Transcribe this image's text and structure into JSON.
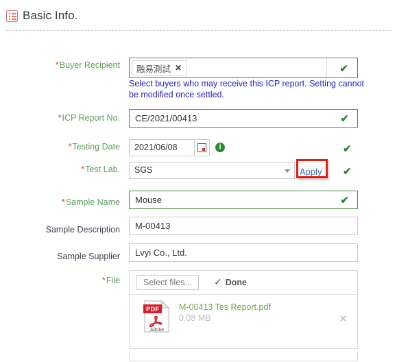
{
  "section": {
    "icon": "list-icon",
    "title": "Basic Info."
  },
  "form": {
    "buyer_recipient": {
      "label": "Buyer Recipient",
      "required_marker": "*",
      "tag": "融易測試",
      "tag_remove": "✕",
      "valid_check": "✔",
      "hint": "Select buyers who may receive this ICP report. Setting cannot be modified once settled."
    },
    "icp_report_no": {
      "label": "ICP Report No.",
      "required_marker": "*",
      "value": "CE/2021/00413",
      "valid_check": "✔"
    },
    "testing_date": {
      "label": "Testing Date",
      "required_marker": "*",
      "value": "2021/06/08",
      "calendar_icon": "calendar-icon",
      "info_icon": "i",
      "valid_check": "✔"
    },
    "test_lab": {
      "label": "Test Lab.",
      "required_marker": "*",
      "value": "SGS",
      "apply_label": "Apply",
      "valid_check": "✔"
    },
    "sample_name": {
      "label": "Sample Name",
      "required_marker": "*",
      "value": "Mouse",
      "valid_check": "✔"
    },
    "sample_description": {
      "label": "Sample Description",
      "value": "M-00413"
    },
    "sample_supplier": {
      "label": "Sample Supplier",
      "value": "Lvyi Co., Ltd."
    },
    "file": {
      "label": "File",
      "required_marker": "*",
      "select_files_label": "Select files...",
      "done_label": "Done",
      "done_check": "✓",
      "items": [
        {
          "name": "M-00413 Tes Report.pdf",
          "size": "0.08 MB",
          "type": "PDF",
          "brand": "Adobe",
          "remove": "✕"
        }
      ]
    }
  },
  "colors": {
    "required_label": "#5b9e5b",
    "asterisk": "#e8392f",
    "valid_border": "#4b8b3b",
    "check": "#2e8b2e",
    "hint": "#2222cc",
    "apply_link": "#3a6fc4",
    "annotation_box": "#e81b0e",
    "file_name": "#6aab48",
    "pdf_red": "#d42027"
  }
}
